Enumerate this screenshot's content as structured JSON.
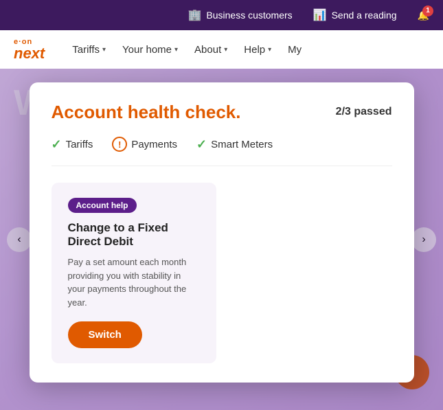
{
  "topbar": {
    "business_label": "Business customers",
    "send_reading_label": "Send a reading",
    "notification_count": "1",
    "business_icon": "🏢",
    "reading_icon": "📊",
    "bell_icon": "🔔"
  },
  "nav": {
    "logo_eon": "e·on",
    "logo_next": "next",
    "items": [
      {
        "label": "Tariffs",
        "id": "tariffs"
      },
      {
        "label": "Your home",
        "id": "your-home"
      },
      {
        "label": "About",
        "id": "about"
      },
      {
        "label": "Help",
        "id": "help"
      },
      {
        "label": "My",
        "id": "my"
      }
    ]
  },
  "modal": {
    "title": "Account health check.",
    "passed": "2/3 passed",
    "checks": [
      {
        "label": "Tariffs",
        "status": "pass",
        "id": "tariffs-check"
      },
      {
        "label": "Payments",
        "status": "warning",
        "id": "payments-check"
      },
      {
        "label": "Smart Meters",
        "status": "pass",
        "id": "smart-meters-check"
      }
    ],
    "card": {
      "badge": "Account help",
      "title": "Change to a Fixed Direct Debit",
      "description": "Pay a set amount each month providing you with stability in your payments throughout the year.",
      "button_label": "Switch"
    }
  }
}
